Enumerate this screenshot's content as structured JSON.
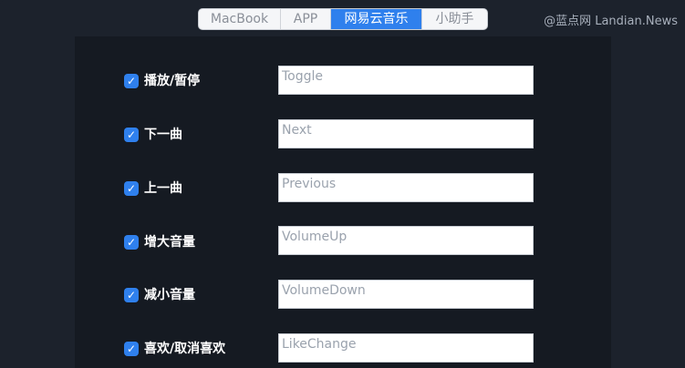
{
  "tabs": [
    {
      "label": "MacBook",
      "active": false
    },
    {
      "label": "APP",
      "active": false
    },
    {
      "label": "网易云音乐",
      "active": true
    },
    {
      "label": "小助手",
      "active": false
    }
  ],
  "watermark": "@蓝点网 Landian.News",
  "rows": [
    {
      "label": "播放/暂停",
      "value": "Toggle",
      "checked": true
    },
    {
      "label": "下一曲",
      "value": "Next",
      "checked": true
    },
    {
      "label": "上一曲",
      "value": "Previous",
      "checked": true
    },
    {
      "label": "增大音量",
      "value": "VolumeUp",
      "checked": true
    },
    {
      "label": "减小音量",
      "value": "VolumeDown",
      "checked": true
    },
    {
      "label": "喜欢/取消喜欢",
      "value": "LikeChange",
      "checked": true
    }
  ],
  "colors": {
    "accent": "#2f80ed",
    "background": "#1c222c"
  },
  "icons": {
    "checkbox": "checkmark-icon"
  }
}
